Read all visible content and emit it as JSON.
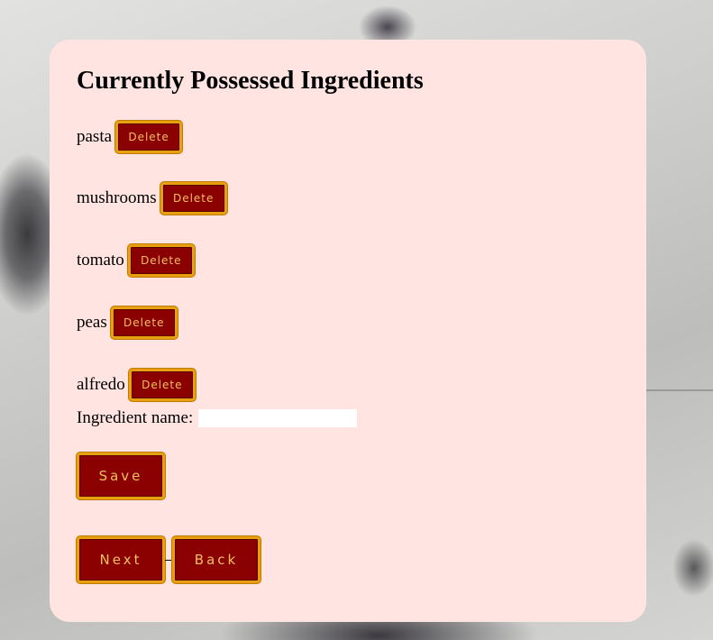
{
  "page": {
    "title": "Currently Possessed Ingredients"
  },
  "ingredients": [
    {
      "name": "pasta",
      "delete_label": "Delete"
    },
    {
      "name": "mushrooms",
      "delete_label": "Delete"
    },
    {
      "name": "tomato",
      "delete_label": "Delete"
    },
    {
      "name": "peas",
      "delete_label": "Delete"
    },
    {
      "name": "alfredo",
      "delete_label": "Delete"
    }
  ],
  "form": {
    "label": "Ingredient name:",
    "value": "",
    "placeholder": "",
    "save_label": "Save"
  },
  "nav": {
    "next_label": "Next",
    "back_label": "Back"
  },
  "colors": {
    "card_background": "#ffe4e1",
    "button_background": "#8b0000",
    "button_border": "#e8a010",
    "button_text": "#f0c060"
  }
}
